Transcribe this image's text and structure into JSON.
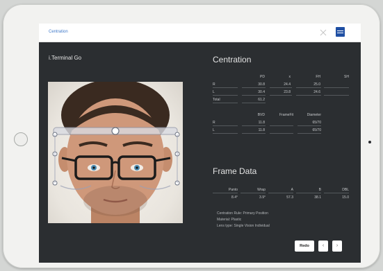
{
  "topbar": {
    "title": "Centration"
  },
  "app_title": "i.Terminal Go",
  "centration": {
    "heading": "Centration",
    "table1": {
      "headers": [
        "",
        "PD",
        "x",
        "FH",
        "SH"
      ],
      "rows": [
        [
          "R",
          "30.8",
          "24.4",
          "25.0",
          ""
        ],
        [
          "L",
          "30.4",
          "23.8",
          "24.6",
          ""
        ],
        [
          "Total",
          "61.2",
          "",
          "",
          ""
        ]
      ]
    },
    "table2": {
      "headers": [
        "",
        "BVD",
        "FrameFit",
        "Diameter"
      ],
      "rows": [
        [
          "R",
          "11.8",
          "",
          "65/70"
        ],
        [
          "L",
          "11.8",
          "",
          "65/70"
        ]
      ]
    }
  },
  "frame_data": {
    "heading": "Frame Data",
    "headers": [
      "Panto",
      "Wrap",
      "A",
      "B",
      "DBL"
    ],
    "values": [
      "8.4°",
      "3.9°",
      "57.3",
      "38.1",
      "15.0"
    ],
    "info": [
      "Centration Rule: Primary Position",
      "Material: Plastic",
      "Lens type: Single Vision Individual"
    ]
  },
  "actions": {
    "redo": "Redo",
    "prev": "‹",
    "next": "›"
  },
  "colors": {
    "accent": "#3f79c9",
    "brand": "#1f4fa3",
    "panel": "#2b2e31"
  }
}
